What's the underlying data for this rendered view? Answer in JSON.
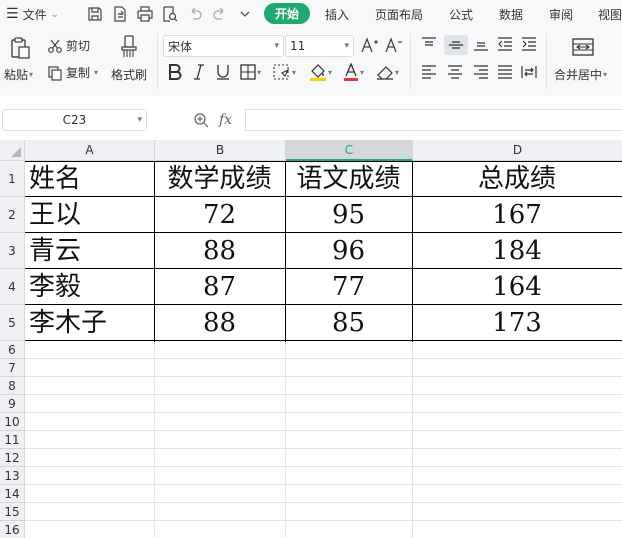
{
  "menu": {
    "file_label": "文件",
    "tabs": [
      "开始",
      "插入",
      "页面布局",
      "公式",
      "数据",
      "审阅",
      "视图"
    ]
  },
  "ribbon": {
    "paste_label": "粘贴",
    "cut_label": "剪切",
    "copy_label": "复制",
    "format_painter_label": "格式刷",
    "font_name": "宋体",
    "font_size": "11",
    "merge_label": "合并居中"
  },
  "formula_bar": {
    "name_box": "C23",
    "fx_label": "fx",
    "formula_value": ""
  },
  "sheet": {
    "active_column": "C",
    "columns": [
      "A",
      "B",
      "C",
      "D"
    ],
    "rows": [
      "1",
      "2",
      "3",
      "4",
      "5",
      "6",
      "7",
      "8",
      "9",
      "10",
      "11",
      "12",
      "13",
      "14",
      "15",
      "16"
    ],
    "header": [
      "姓名",
      "数学成绩",
      "语文成绩",
      "总成绩"
    ],
    "data": [
      [
        "王以",
        "72",
        "95",
        "167"
      ],
      [
        "青云",
        "88",
        "96",
        "184"
      ],
      [
        "李毅",
        "87",
        "77",
        "164"
      ],
      [
        "李木子",
        "88",
        "85",
        "173"
      ]
    ]
  },
  "colors": {
    "accent": "#1fa970",
    "font_color_bar": "#e03b3b",
    "fill_color_bar": "#f5d000"
  }
}
